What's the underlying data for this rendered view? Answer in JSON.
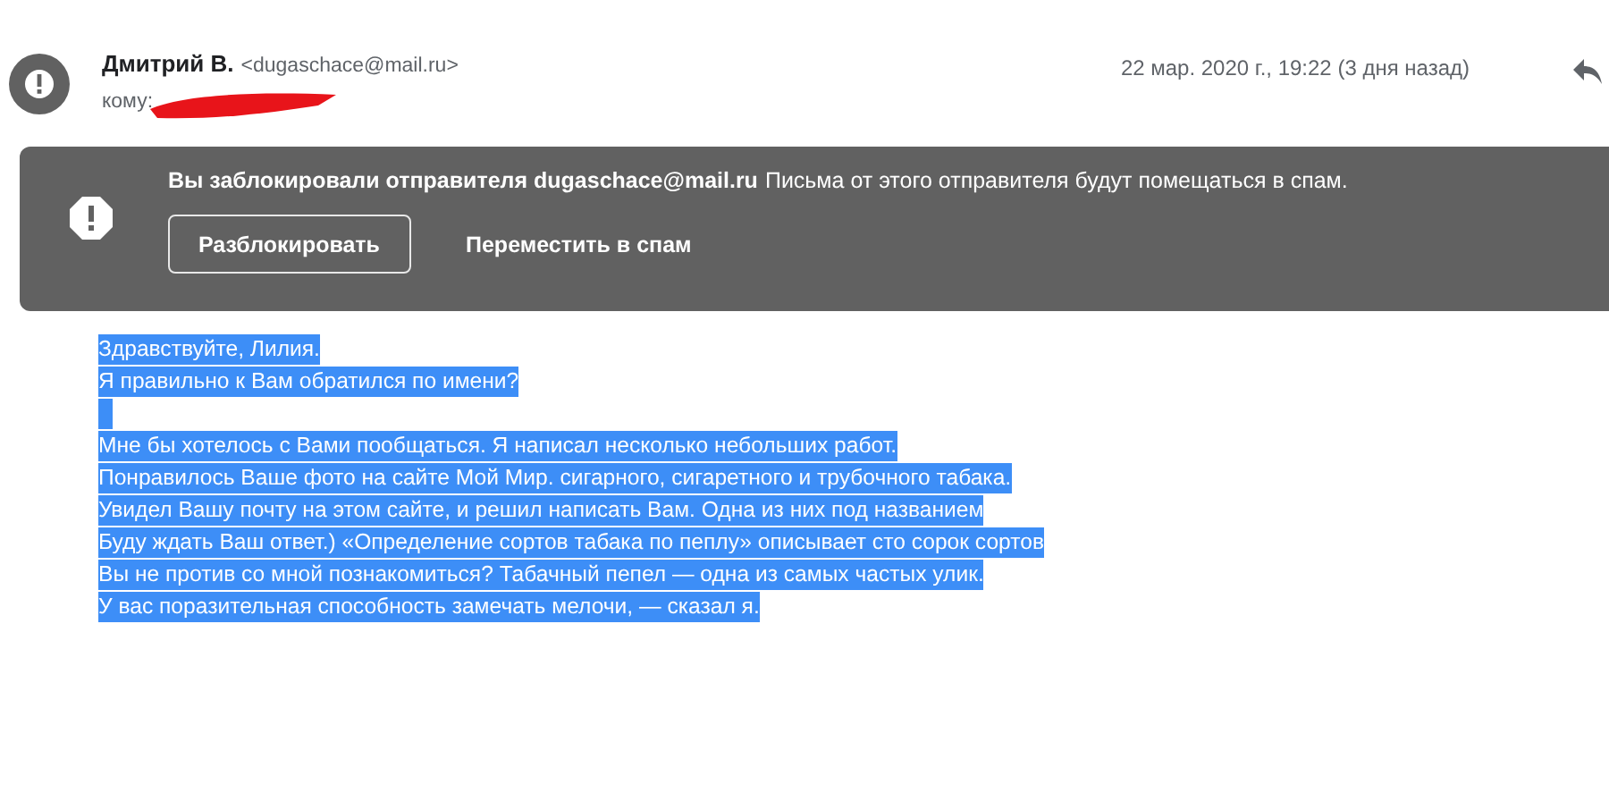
{
  "sender": {
    "name": "Дмитрий В.",
    "email": "<dugaschace@mail.ru>",
    "to_label": "кому:"
  },
  "date": "22 мар. 2020 г., 19:22 (3 дня назад)",
  "banner": {
    "title": "Вы заблокировали отправителя dugaschace@mail.ru",
    "message": "Письма от этого отправителя будут помещаться в спам.",
    "buttons": [
      {
        "label": "Разблокировать",
        "kind": "outlined"
      },
      {
        "label": "Переместить в спам",
        "kind": "text"
      }
    ]
  },
  "body": {
    "selected": true,
    "paragraphs": [
      [
        "Здравствуйте, Лилия.",
        "Я правильно к Вам обратился по имени?"
      ],
      [
        "Мне бы хотелось с Вами пообщаться. Я написал несколько небольших работ.",
        "Понравилось Ваше фото на сайте Мой Мир. сигарного, сигаретного и трубочного табака.",
        "Увидел Вашу почту на этом сайте, и решил написать Вам. Одна из них под названием",
        "Буду ждать Ваш ответ.) «Определение сортов табака по пеплу» описывает сто сорок сортов",
        "Вы не против со мной познакомиться? Табачный пепел — одна из самых частых улик.",
        "У вас поразительная способность замечать мелочи, — сказал я."
      ]
    ]
  }
}
